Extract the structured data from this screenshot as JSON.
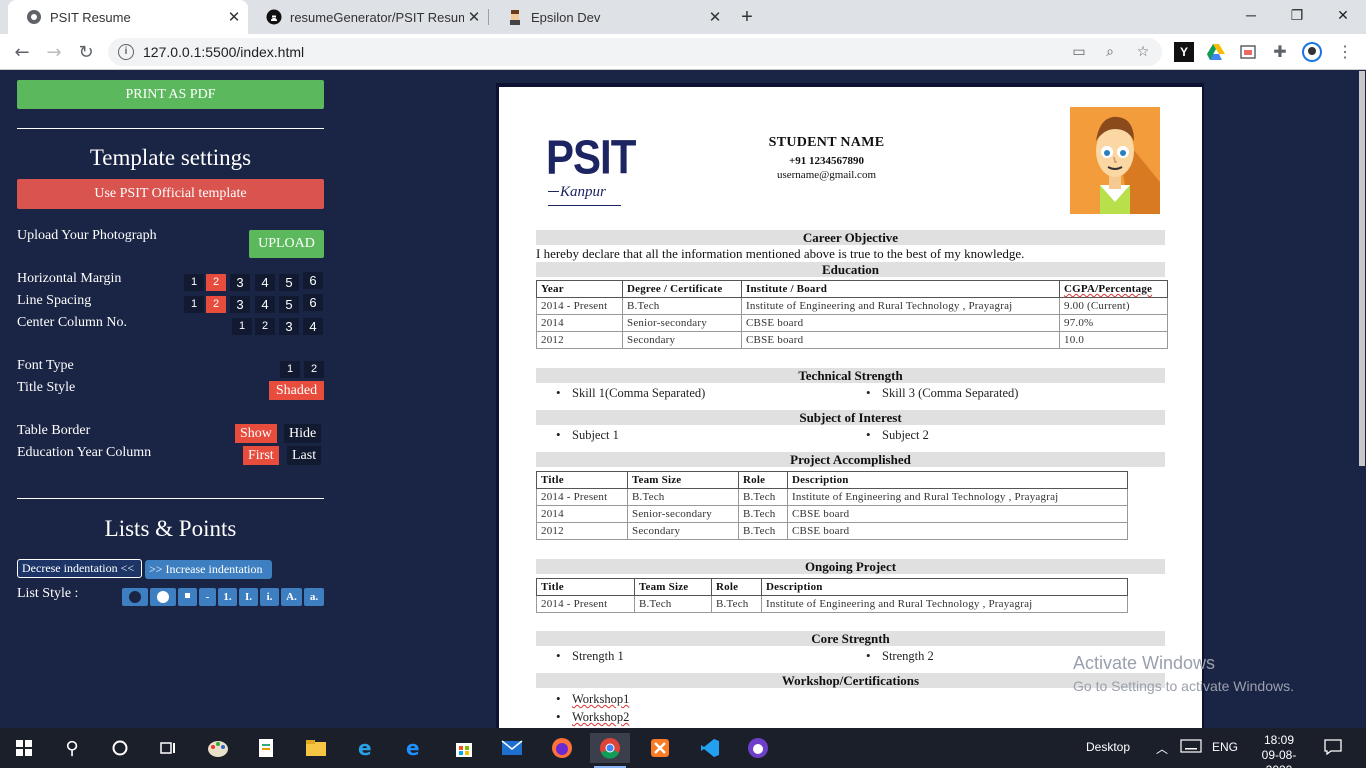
{
  "browser": {
    "tabs": [
      {
        "title": "PSIT Resume",
        "active": true
      },
      {
        "title": "resumeGenerator/PSIT Resume.p",
        "active": false
      },
      {
        "title": "Epsilon Dev",
        "active": false
      }
    ],
    "url": "127.0.0.1:5500/index.html",
    "ext_y": "Y"
  },
  "panel": {
    "print_button": "PRINT AS PDF",
    "template_heading": "Template settings",
    "official_template_button": "Use PSIT Official template",
    "upload_label": "Upload Your Photograph",
    "upload_button": "UPLOAD",
    "horizontal_margin_label": "Horizontal Margin",
    "horizontal_margin_options": [
      "1",
      "2",
      "3",
      "4",
      "5",
      "6"
    ],
    "line_spacing_label": "Line Spacing",
    "line_spacing_options": [
      "1",
      "2",
      "3",
      "4",
      "5",
      "6"
    ],
    "center_column_label": "Center Column No.",
    "center_column_options": [
      "1",
      "2",
      "3",
      "4"
    ],
    "font_type_label": "Font Type",
    "font_type_options": [
      "1",
      "2"
    ],
    "title_style_label": "Title Style",
    "title_style_value": "Shaded",
    "table_border_label": "Table Border",
    "table_border_show": "Show",
    "table_border_hide": "Hide",
    "edu_year_label": "Education Year Column",
    "edu_year_first": "First",
    "edu_year_last": "Last",
    "lists_heading": "Lists & Points",
    "decrease_indent": "Decrese indentation <<",
    "increase_indent": ">> Increase indentation",
    "list_style_label": "List Style :",
    "list_style_options": [
      "1.",
      "I.",
      "i.",
      "A.",
      "a."
    ],
    "list_style_dash": "-"
  },
  "resume": {
    "logo_text": "PSIT",
    "logo_sub": "Kanpur",
    "student_name": "STUDENT NAME",
    "phone": "+91 1234567890",
    "email": "username@gmail.com",
    "career_title": "Career Objective",
    "career_text": "I hereby declare that all the information mentioned above is true to the best of my knowledge.",
    "education_title": "Education",
    "education_headers": [
      "Year",
      "Degree / Certificate",
      "Institute / Board",
      "CGPA/Percentage"
    ],
    "education_rows": [
      [
        "2014 - Present",
        "B.Tech",
        "Institute of Engineering and Rural Technology , Prayagraj",
        "9.00 (Current)"
      ],
      [
        "2014",
        "Senior-secondary",
        "CBSE board",
        "97.0%"
      ],
      [
        "2012",
        "Secondary",
        "CBSE board",
        "10.0"
      ]
    ],
    "technical_title": "Technical Strength",
    "technical_items": [
      "Skill 1(Comma Separated)",
      "Skill 3 (Comma Separated)"
    ],
    "interest_title": "Subject of Interest",
    "interest_items": [
      "Subject 1",
      "Subject 2"
    ],
    "projects_title": "Project Accomplished",
    "projects_headers": [
      "Title",
      "Team Size",
      "Role",
      "Description"
    ],
    "projects_rows": [
      [
        "2014 - Present",
        "B.Tech",
        "B.Tech",
        "Institute of Engineering and Rural Technology , Prayagraj"
      ],
      [
        "2014",
        "Senior-secondary",
        "B.Tech",
        "CBSE board"
      ],
      [
        "2012",
        "Secondary",
        "B.Tech",
        "CBSE board"
      ]
    ],
    "ongoing_title": "Ongoing Project",
    "ongoing_headers": [
      "Title",
      "Team Size",
      "Role",
      "Description"
    ],
    "ongoing_rows": [
      [
        "2014 - Present",
        "B.Tech",
        "B.Tech",
        "Institute of Engineering and Rural Technology , Prayagraj"
      ]
    ],
    "core_title": "Core Stregnth",
    "core_items": [
      "Strength 1",
      "Strength 2"
    ],
    "workshop_title": "Workshop/Certifications",
    "workshop_items": [
      "Workshop1",
      "Workshop2"
    ]
  },
  "watermark": {
    "line1": "Activate Windows",
    "line2": "Go to Settings to activate Windows."
  },
  "taskbar": {
    "desktop_label": "Desktop",
    "lang": "ENG",
    "time": "18:09",
    "date": "09-08-2020"
  }
}
